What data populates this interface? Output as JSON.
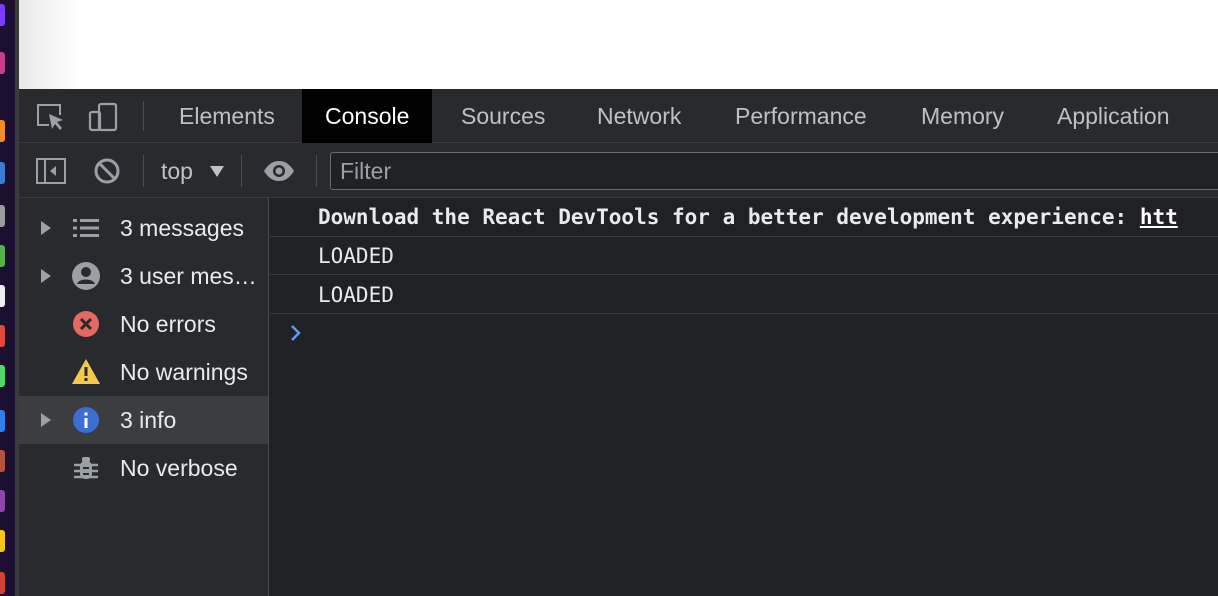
{
  "tabs": [
    "Elements",
    "Console",
    "Sources",
    "Network",
    "Performance",
    "Memory",
    "Application"
  ],
  "active_tab": "Console",
  "toolbar": {
    "context": "top",
    "filter_placeholder": "Filter"
  },
  "sidebar": {
    "items": [
      {
        "label": "3 messages",
        "icon": "list-icon",
        "expandable": true
      },
      {
        "label": "3 user mes…",
        "icon": "user-icon",
        "expandable": true
      },
      {
        "label": "No errors",
        "icon": "error-icon",
        "expandable": false
      },
      {
        "label": "No warnings",
        "icon": "warning-icon",
        "expandable": false
      },
      {
        "label": "3 info",
        "icon": "info-icon",
        "expandable": true,
        "selected": true
      },
      {
        "label": "No verbose",
        "icon": "bug-icon",
        "expandable": false
      }
    ]
  },
  "console": {
    "messages": [
      {
        "text": "Download the React DevTools for a better development experience: ",
        "link": "htt"
      },
      {
        "text": "LOADED"
      },
      {
        "text": "LOADED"
      }
    ]
  },
  "colors": {
    "background": "#202124",
    "panel": "#292a2d",
    "active_tab": "#000000",
    "error": "#e46962",
    "warning": "#f2c94c",
    "info": "#3b6fd6",
    "prompt": "#5c9cf5"
  }
}
